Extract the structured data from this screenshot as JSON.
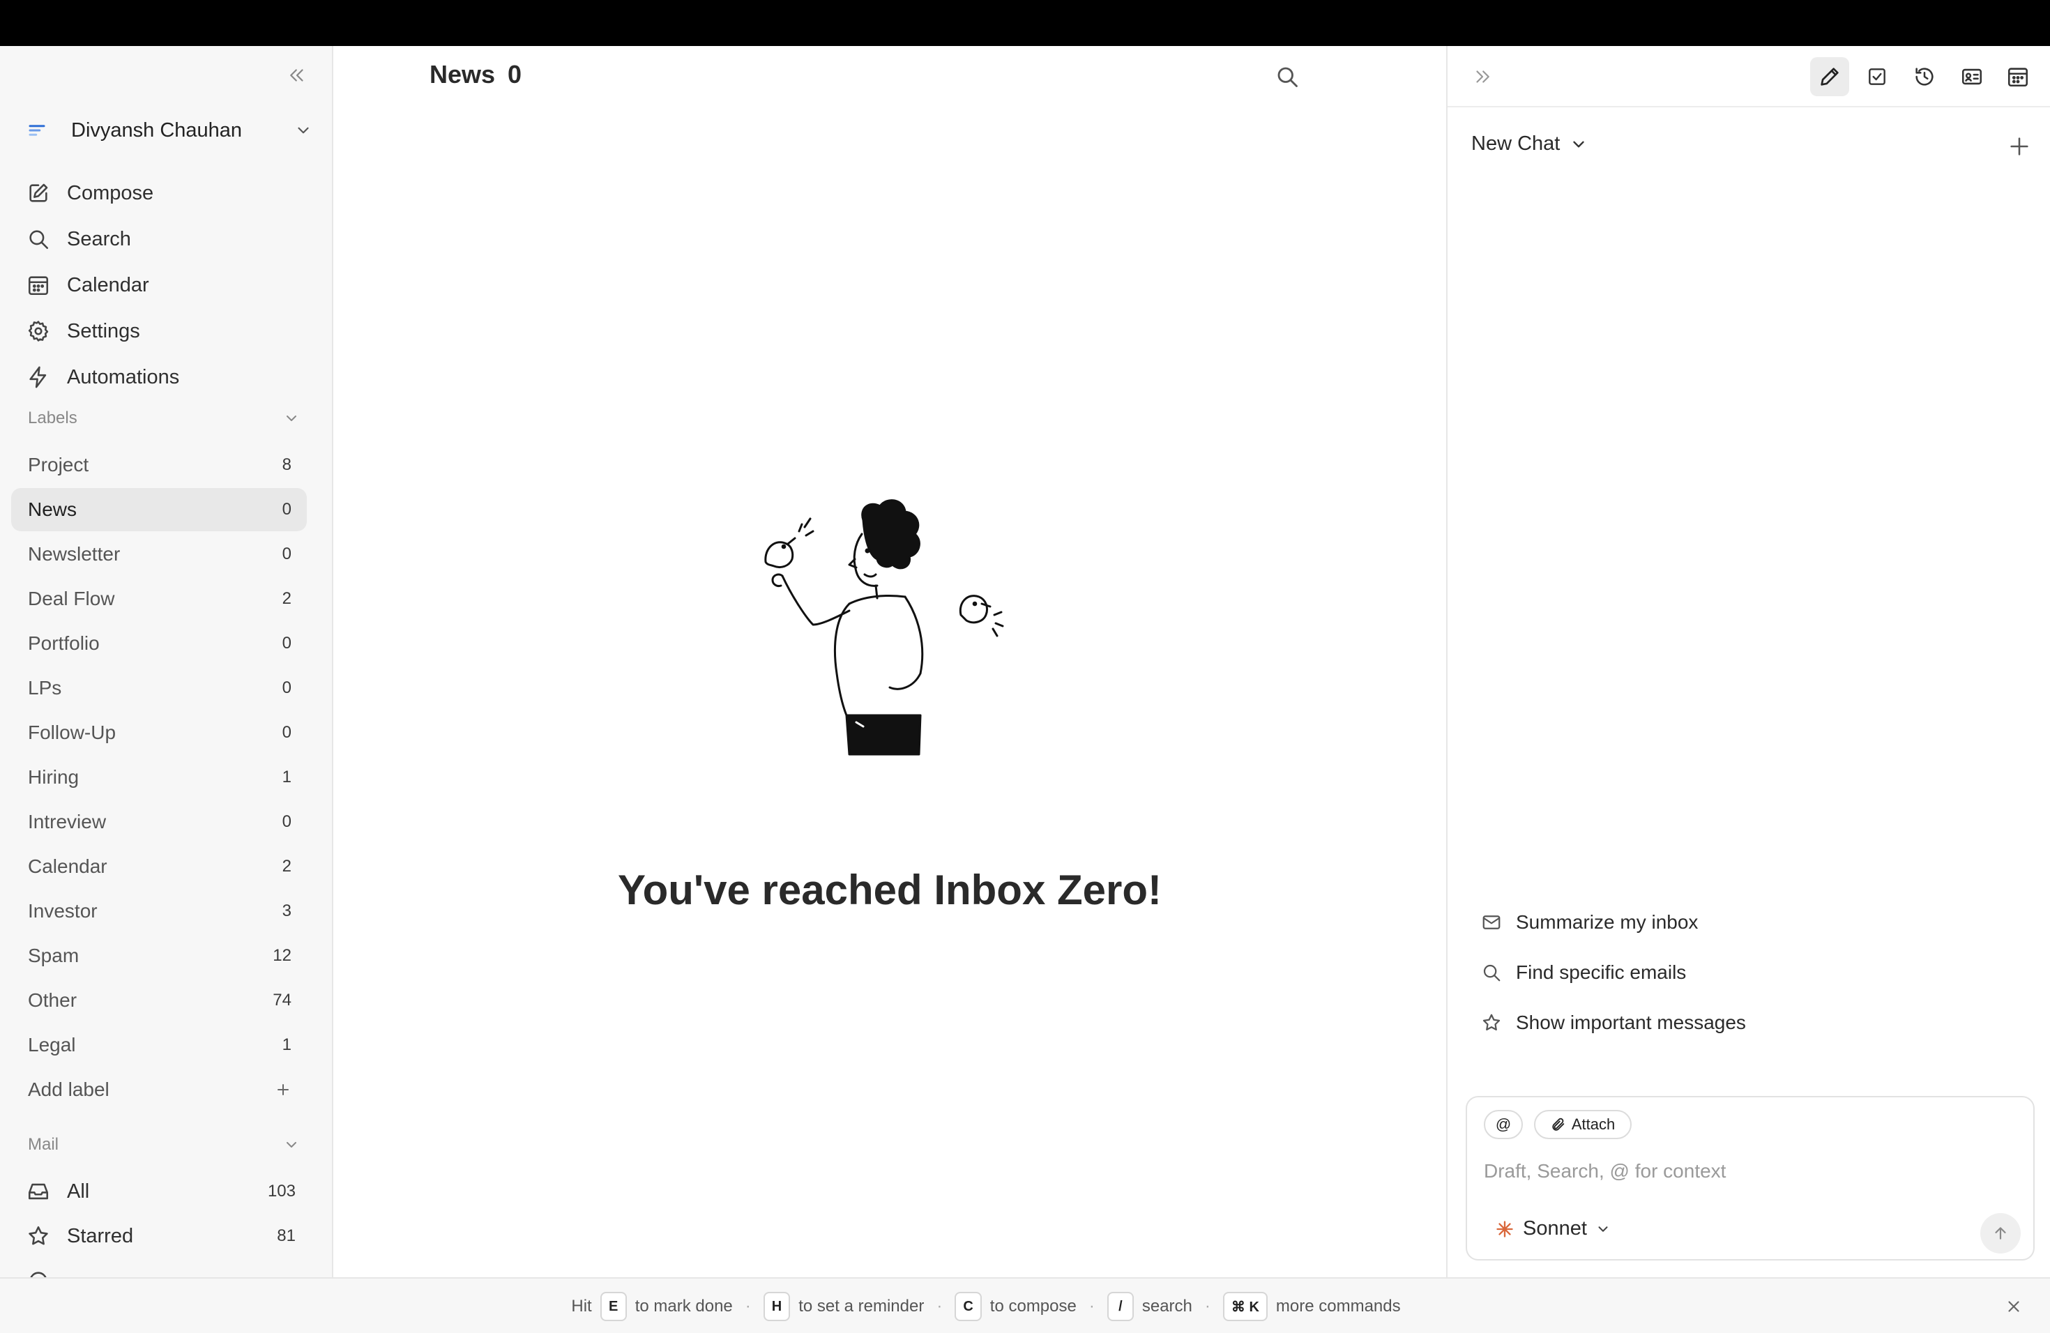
{
  "account": {
    "name": "Divyansh Chauhan"
  },
  "nav": [
    {
      "label": "Compose",
      "icon": "compose-icon"
    },
    {
      "label": "Search",
      "icon": "search-icon"
    },
    {
      "label": "Calendar",
      "icon": "calendar-icon"
    },
    {
      "label": "Settings",
      "icon": "gear-icon"
    },
    {
      "label": "Automations",
      "icon": "lightning-icon"
    }
  ],
  "labels_header": "Labels",
  "labels": [
    {
      "label": "Project",
      "count": "8"
    },
    {
      "label": "News",
      "count": "0",
      "active": true
    },
    {
      "label": "Newsletter",
      "count": "0"
    },
    {
      "label": "Deal Flow",
      "count": "2"
    },
    {
      "label": "Portfolio",
      "count": "0"
    },
    {
      "label": "LPs",
      "count": "0"
    },
    {
      "label": "Follow-Up",
      "count": "0"
    },
    {
      "label": "Hiring",
      "count": "1"
    },
    {
      "label": "Intreview",
      "count": "0"
    },
    {
      "label": "Calendar",
      "count": "2"
    },
    {
      "label": "Investor",
      "count": "3"
    },
    {
      "label": "Spam",
      "count": "12"
    },
    {
      "label": "Other",
      "count": "74"
    },
    {
      "label": "Legal",
      "count": "1"
    }
  ],
  "add_label": "Add label",
  "mail_header": "Mail",
  "mail": [
    {
      "label": "All",
      "count": "103",
      "icon": "inbox-icon"
    },
    {
      "label": "Starred",
      "count": "81",
      "icon": "star-icon"
    }
  ],
  "main": {
    "title": "News",
    "count": "0",
    "empty_message": "You've reached Inbox Zero!"
  },
  "chat": {
    "title": "New Chat",
    "suggestions": [
      {
        "label": "Summarize my inbox",
        "icon": "mail-icon"
      },
      {
        "label": "Find specific emails",
        "icon": "search-icon"
      },
      {
        "label": "Show important messages",
        "icon": "star-icon"
      }
    ],
    "mention_label": "@",
    "attach_label": "Attach",
    "placeholder": "Draft, Search, @ for context",
    "model": "Sonnet"
  },
  "footer": {
    "hit": "Hit",
    "hints": [
      {
        "key": "E",
        "text": "to mark done"
      },
      {
        "key": "H",
        "text": "to set a reminder"
      },
      {
        "key": "C",
        "text": "to compose"
      },
      {
        "key": "/",
        "text": "search"
      },
      {
        "key": "⌘ K",
        "text": "more commands"
      }
    ]
  },
  "colors": {
    "accent": "#2f6fd6",
    "sonnet": "#d9673b",
    "active_row": "#e8e8e8"
  }
}
